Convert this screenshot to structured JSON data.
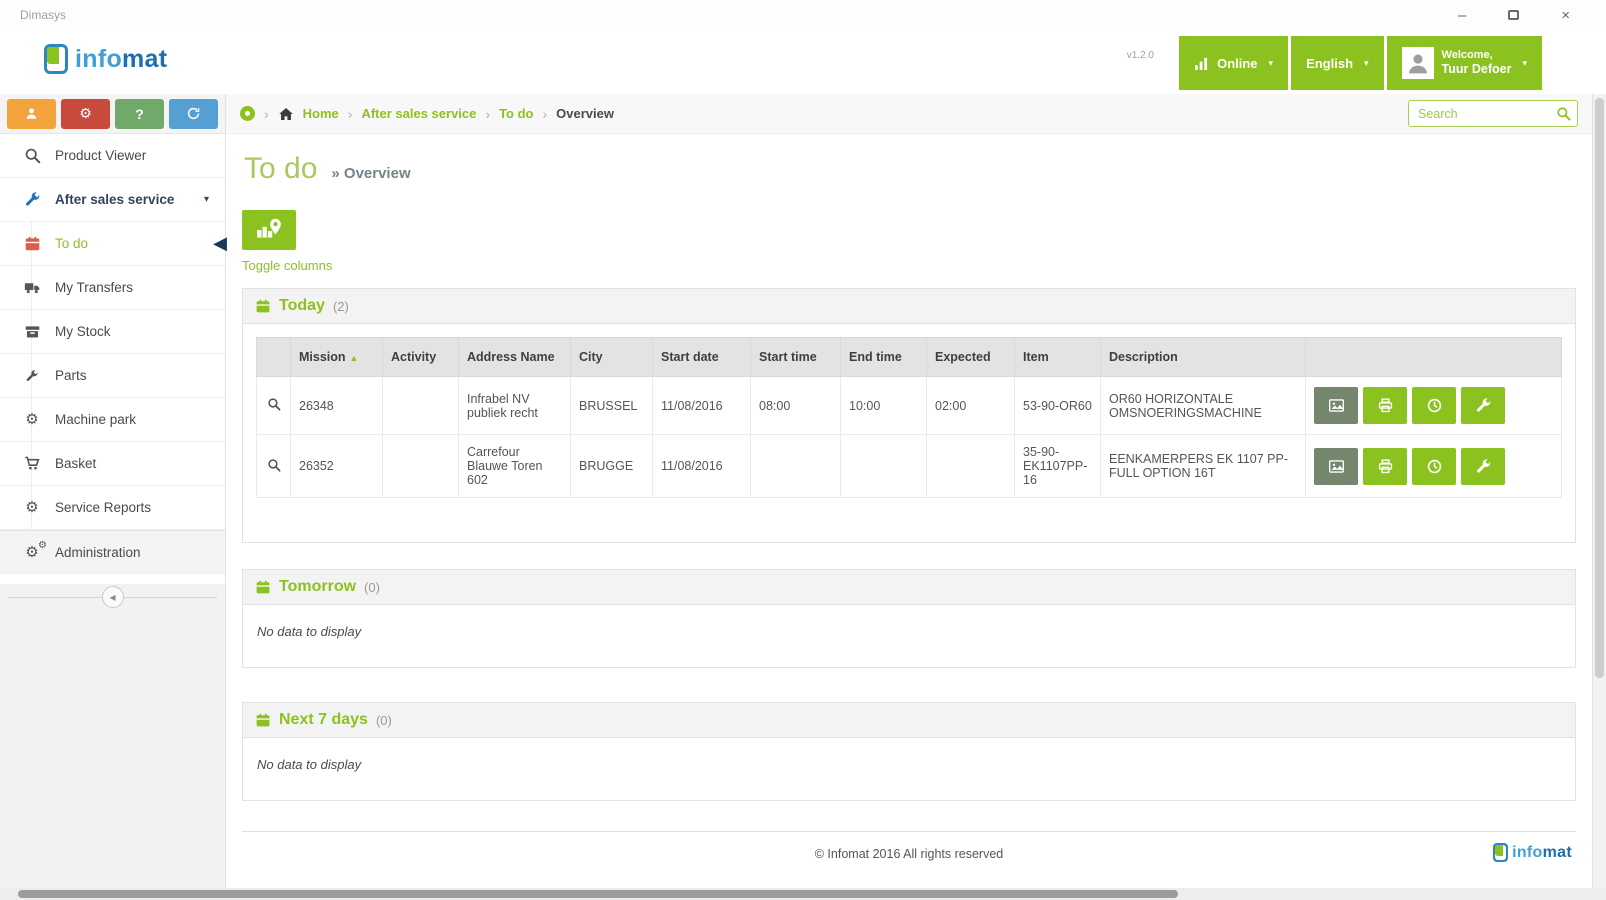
{
  "window": {
    "title": "Dimasys",
    "minimize_glyph": "–",
    "close_glyph": "×"
  },
  "brand": {
    "prefix": "info",
    "suffix": "mat"
  },
  "header": {
    "version": "v1.2.0",
    "online": {
      "label": "Online"
    },
    "language": {
      "label": "English"
    },
    "user": {
      "welcome": "Welcome,",
      "name": "Tuur Defoer"
    }
  },
  "sidebar": {
    "help_glyph": "?",
    "items": [
      {
        "label": "Product Viewer"
      },
      {
        "label": "After sales service"
      },
      {
        "label": "To do"
      },
      {
        "label": "My Transfers"
      },
      {
        "label": "My Stock"
      },
      {
        "label": "Parts"
      },
      {
        "label": "Machine park"
      },
      {
        "label": "Basket"
      },
      {
        "label": "Service Reports"
      },
      {
        "label": "Administration"
      }
    ]
  },
  "breadcrumb": {
    "items": [
      "Home",
      "After sales service",
      "To do",
      "Overview"
    ]
  },
  "search": {
    "placeholder": "Search"
  },
  "page": {
    "title": "To do",
    "subtitle": "» Overview",
    "toggle_columns": "Toggle columns"
  },
  "panels": {
    "today": {
      "title": "Today",
      "count": "(2)"
    },
    "tomorrow": {
      "title": "Tomorrow",
      "count": "(0)",
      "empty": "No data to display"
    },
    "next7": {
      "title": "Next 7 days",
      "count": "(0)",
      "empty": "No data to display"
    }
  },
  "table": {
    "headers": [
      "Mission",
      "Activity",
      "Address Name",
      "City",
      "Start date",
      "Start time",
      "End time",
      "Expected",
      "Item",
      "Description"
    ],
    "rows": [
      {
        "mission": "26348",
        "activity": "",
        "address_name": "Infrabel NV publiek recht",
        "city": "BRUSSEL",
        "start_date": "11/08/2016",
        "start_time": "08:00",
        "end_time": "10:00",
        "expected": "02:00",
        "item": "53-90-OR60",
        "description": "OR60 HORIZONTALE OMSNOERINGSMACHINE"
      },
      {
        "mission": "26352",
        "activity": "",
        "address_name": "Carrefour Blauwe Toren 602",
        "city": "BRUGGE",
        "start_date": "11/08/2016",
        "start_time": "",
        "end_time": "",
        "expected": "",
        "item": "35-90-EK1107PP-16",
        "description": "EENKAMERPERS EK 1107 PP-FULL OPTION 16T"
      }
    ]
  },
  "footer": {
    "copyright": "© Infomat 2016 All rights reserved"
  },
  "icons": {
    "caret_down": "▾",
    "sort_asc": "▲",
    "active_marker": "◀",
    "collapse_arrow": "◂",
    "crumb_sep": "›",
    "gear": "⚙"
  },
  "colors": {
    "accent_green": "#8cc21f",
    "action_sage": "#75866e",
    "nav_navy": "#17395c",
    "todo_red": "#dd5f4a",
    "quick_orange": "#f2a33c",
    "quick_red": "#c74a3c",
    "quick_green": "#71a96a",
    "quick_blue": "#55a0d3",
    "logo_blue": "#2e86c1"
  }
}
